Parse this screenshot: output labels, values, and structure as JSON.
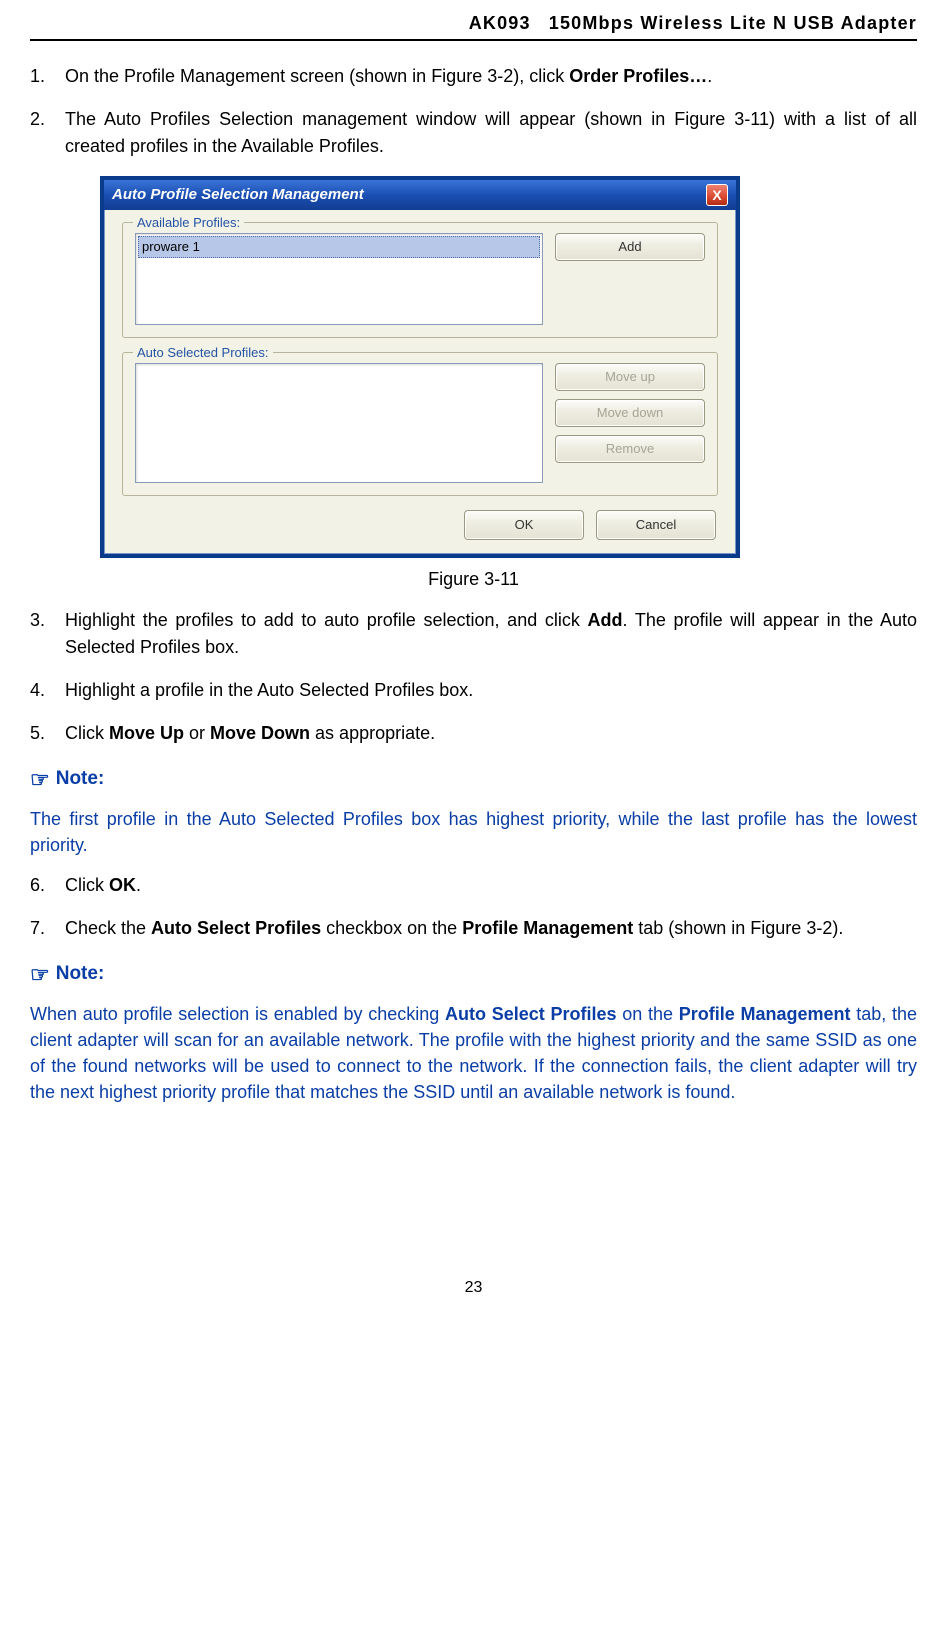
{
  "header": {
    "model": "AK093",
    "title": "150Mbps Wireless Lite N USB Adapter"
  },
  "steps_a": [
    {
      "n": "1.",
      "pre": "On the Profile Management screen (shown in Figure 3-2), click ",
      "b": "Order Profiles…",
      "post": "."
    },
    {
      "n": "2.",
      "pre": "The Auto Profiles Selection management window will appear (shown in Figure 3-11) with a list of all created profiles in the Available Profiles.",
      "b": "",
      "post": ""
    }
  ],
  "dialog": {
    "title": "Auto Profile Selection Management",
    "close": "X",
    "group1_label": "Available Profiles:",
    "available_item": "proware 1",
    "add": "Add",
    "group2_label": "Auto Selected Profiles:",
    "moveup": "Move up",
    "movedown": "Move down",
    "remove": "Remove",
    "ok": "OK",
    "cancel": "Cancel"
  },
  "figure_caption": "Figure 3-11",
  "steps_b": [
    {
      "n": "3.",
      "pre": "Highlight the profiles to add to auto profile selection, and click ",
      "b": "Add",
      "post": ". The profile will appear in the Auto Selected Profiles box."
    },
    {
      "n": "4.",
      "pre": "Highlight a profile in the Auto Selected Profiles box.",
      "b": "",
      "post": ""
    },
    {
      "n": "5.",
      "t1": "Click ",
      "b1": "Move Up",
      "t2": " or ",
      "b2": "Move Down",
      "t3": " as appropriate."
    }
  ],
  "note1_head": "Note:",
  "note1_body": "The first profile in the Auto Selected Profiles box has highest priority, while the last profile has the lowest priority.",
  "steps_c": [
    {
      "n": "6.",
      "t1": "Click ",
      "b1": "OK",
      "t2": "."
    },
    {
      "n": "7.",
      "t1": "Check the ",
      "b1": "Auto Select Profiles",
      "t2": " checkbox on the ",
      "b2": "Profile Management",
      "t3": " tab (shown in Figure 3-2)."
    }
  ],
  "note2_head": "Note:",
  "note2_body_parts": {
    "t1": "When auto profile selection is enabled by checking ",
    "b1": "Auto Select Profiles",
    "t2": " on the ",
    "b2": "Profile Management",
    "t3": " tab, the client adapter will scan for an available network. The profile with the highest priority and the same SSID as one of the found networks will be used to connect to the network. If the connection fails, the client adapter will try the next highest priority profile that matches the SSID until an available network is found."
  },
  "pagenum": "23"
}
